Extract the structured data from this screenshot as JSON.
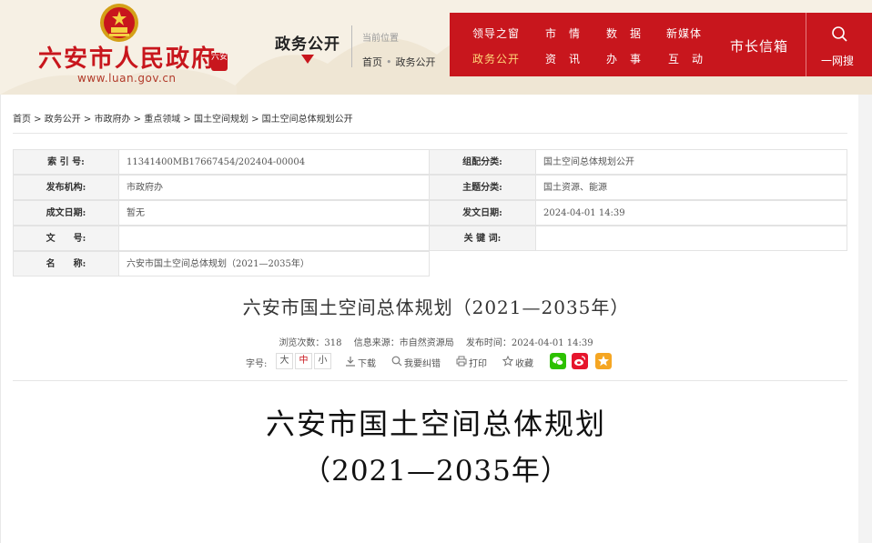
{
  "header": {
    "site_name": "六安市人民政府",
    "seal_text": "六安",
    "url": "www.luan.gov.cn",
    "section_title": "政务公开",
    "location_label": "当前位置",
    "location_path": [
      "首页",
      "政务公开"
    ]
  },
  "nav": {
    "items": [
      {
        "label": "领导之窗",
        "active": true
      },
      {
        "label": "政务公开",
        "active": true
      },
      {
        "label": "市　情",
        "active": false
      },
      {
        "label": "资　讯",
        "active": false
      },
      {
        "label": "数　据",
        "active": false
      },
      {
        "label": "办　事",
        "active": false
      },
      {
        "label": "新媒体",
        "active": false
      },
      {
        "label": "互　动",
        "active": false
      }
    ],
    "mayor_mailbox": "市长信箱",
    "search_label": "一网搜"
  },
  "breadcrumb": "首页 > 政务公开 > 市政府办 > 重点领域 > 国土空间规划 > 国土空间总体规划公开",
  "meta": {
    "rows": [
      {
        "l1": "索 引 号:",
        "v1": "11341400MB17667454/202404-00004",
        "l2": "组配分类:",
        "v2": "国土空间总体规划公开"
      },
      {
        "l1": "发布机构:",
        "v1": "市政府办",
        "l2": "主题分类:",
        "v2": "国土资源、能源"
      },
      {
        "l1": "成文日期:",
        "v1": "暂无",
        "l2": "发文日期:",
        "v2": "2024-04-01 14:39"
      },
      {
        "l1": "文　　号:",
        "v1": "",
        "l2": "关 键 词:",
        "v2": ""
      },
      {
        "l1": "名　　称:",
        "v1": "六安市国土空间总体规划（2021—2035年）"
      }
    ]
  },
  "article": {
    "title": "六安市国土空间总体规划（2021—2035年）",
    "views": "浏览次数：318",
    "source": "信息来源：市自然资源局",
    "publish_time": "发布时间：2024-04-01 14:39",
    "font_size_label": "字号:",
    "font_sizes": [
      "大",
      "中",
      "小"
    ],
    "download": "下载",
    "report_error": "我要纠错",
    "print": "打印",
    "favorite": "收藏",
    "doc_title_line1": "六安市国土空间总体规划",
    "doc_title_line2": "（2021—2035年）"
  },
  "colors": {
    "brand_red": "#c8161d",
    "nav_active": "#ffd97a",
    "wechat": "#2dc100",
    "weibo": "#e6162d",
    "qzone": "#f5a623"
  }
}
